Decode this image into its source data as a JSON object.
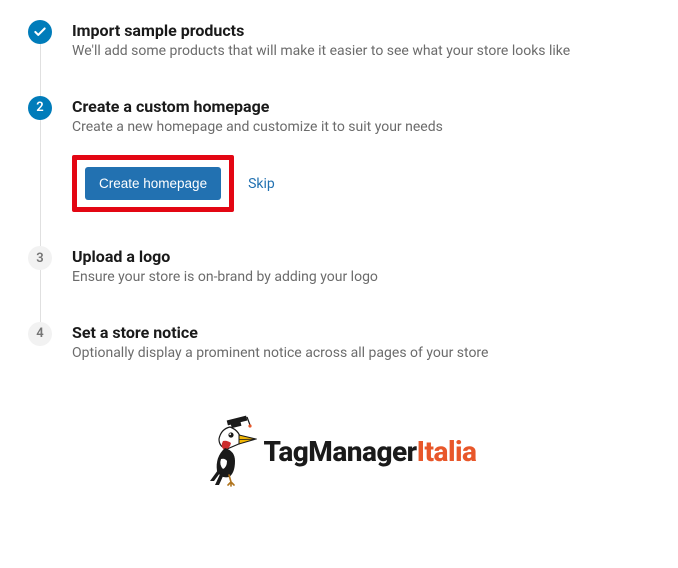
{
  "steps": [
    {
      "indicator": "check",
      "title": "Import sample products",
      "desc": "We'll add some products that will make it easier to see what your store looks like"
    },
    {
      "indicator": "2",
      "title": "Create a custom homepage",
      "desc": "Create a new homepage and customize it to suit your needs",
      "button": "Create homepage",
      "skip": "Skip"
    },
    {
      "indicator": "3",
      "title": "Upload a logo",
      "desc": "Ensure your store is on-brand by adding your logo"
    },
    {
      "indicator": "4",
      "title": "Set a store notice",
      "desc": "Optionally display a prominent notice across all pages of your store"
    }
  ],
  "logo": {
    "text_main": "TagManager",
    "text_accent": "Italia"
  }
}
